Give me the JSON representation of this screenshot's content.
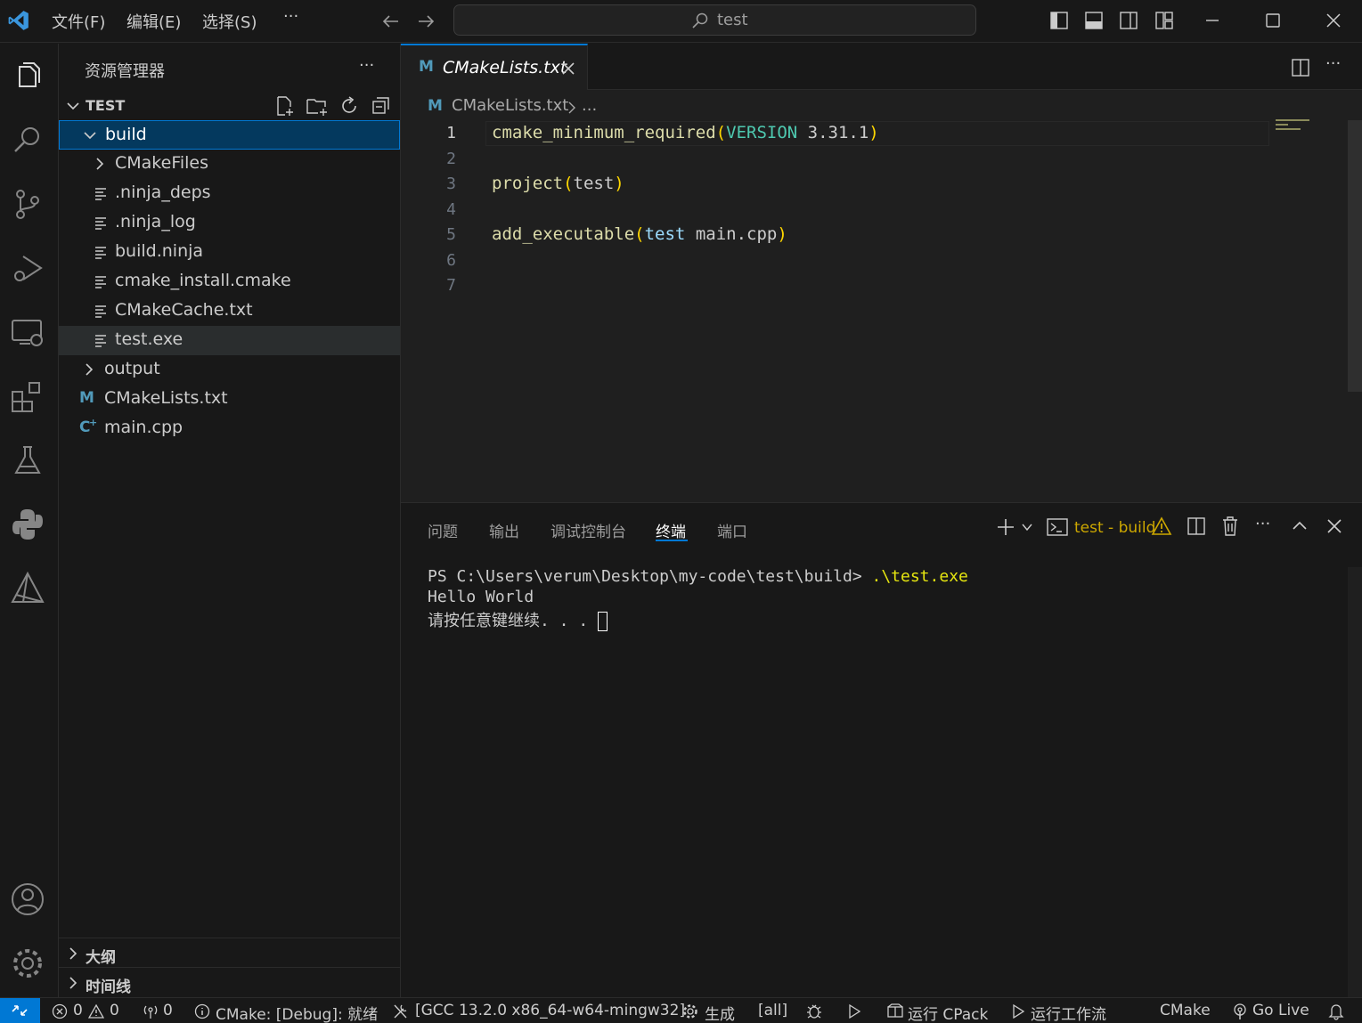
{
  "titlebar": {
    "menus": [
      "文件(F)",
      "编辑(E)",
      "选择(S)",
      "···"
    ],
    "search_text": "test"
  },
  "sidebar": {
    "title": "资源管理器",
    "more": "···",
    "root_label": "TEST",
    "items": [
      {
        "label": "build",
        "type": "folder-open",
        "depth": 0
      },
      {
        "label": "CMakeFiles",
        "type": "folder",
        "depth": 1
      },
      {
        "label": ".ninja_deps",
        "type": "file",
        "depth": 1
      },
      {
        "label": ".ninja_log",
        "type": "file",
        "depth": 1
      },
      {
        "label": "build.ninja",
        "type": "file",
        "depth": 1
      },
      {
        "label": "cmake_install.cmake",
        "type": "file",
        "depth": 1
      },
      {
        "label": "CMakeCache.txt",
        "type": "file",
        "depth": 1
      },
      {
        "label": "test.exe",
        "type": "file",
        "depth": 1
      },
      {
        "label": "output",
        "type": "folder",
        "depth": 0
      },
      {
        "label": "CMakeLists.txt",
        "type": "cmake",
        "depth": 0
      },
      {
        "label": "main.cpp",
        "type": "cpp",
        "depth": 0
      }
    ],
    "bottom_sections": [
      "大纲",
      "时间线"
    ]
  },
  "editor": {
    "tab_label": "CMakeLists.txt",
    "breadcrumb_file": "CMakeLists.txt",
    "breadcrumb_more": "...",
    "line_numbers": [
      "1",
      "2",
      "3",
      "4",
      "5",
      "6",
      "7"
    ],
    "code": {
      "l1_fn": "cmake_minimum_required",
      "l1_open": "(",
      "l1_kw": "VERSION",
      "l1_val": " 3.31.1",
      "l1_close": ")",
      "l3_fn": "project",
      "l3_open": "(",
      "l3_arg": "test",
      "l3_close": ")",
      "l5_fn": "add_executable",
      "l5_open": "(",
      "l5_arg1": "test",
      "l5_arg2": " main.cpp",
      "l5_close": ")"
    }
  },
  "panel": {
    "tabs": [
      "问题",
      "输出",
      "调试控制台",
      "终端",
      "端口"
    ],
    "active_tab": "终端",
    "terminal_name": "test - build",
    "terminal_lines": {
      "prompt": "PS C:\\Users\\verum\\Desktop\\my-code\\test\\build> ",
      "command": ".\\test.exe",
      "output1": "Hello World",
      "output2": "请按任意键继续. . . "
    }
  },
  "statusbar": {
    "errors": "0",
    "warnings": "0",
    "ports": "0",
    "cmake_status": "CMake: [Debug]: 就绪",
    "kit": "[GCC 13.2.0 x86_64-w64-mingw32]",
    "build": "生成",
    "target": "[all]",
    "cpack": "运行 CPack",
    "workflow": "运行工作流",
    "cmake": "CMake",
    "golive": "Go Live"
  },
  "colors": {
    "accent": "#0078d4",
    "selection": "#04395e",
    "function": "#dcdcaa",
    "keyword": "#4ec9b0",
    "variable": "#9cdcfe",
    "bracket": "#ffd700",
    "warning": "#cca700",
    "cmake_icon": "#519aba"
  }
}
